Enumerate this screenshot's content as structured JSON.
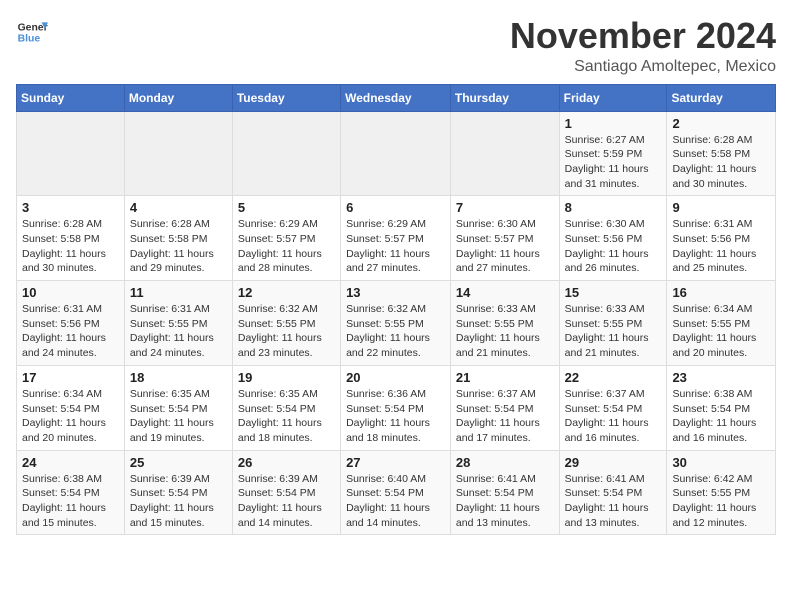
{
  "logo": {
    "line1": "General",
    "line2": "Blue"
  },
  "title": "November 2024",
  "location": "Santiago Amoltepec, Mexico",
  "days_of_week": [
    "Sunday",
    "Monday",
    "Tuesday",
    "Wednesday",
    "Thursday",
    "Friday",
    "Saturday"
  ],
  "weeks": [
    [
      {
        "day": "",
        "info": ""
      },
      {
        "day": "",
        "info": ""
      },
      {
        "day": "",
        "info": ""
      },
      {
        "day": "",
        "info": ""
      },
      {
        "day": "",
        "info": ""
      },
      {
        "day": "1",
        "info": "Sunrise: 6:27 AM\nSunset: 5:59 PM\nDaylight: 11 hours and 31 minutes."
      },
      {
        "day": "2",
        "info": "Sunrise: 6:28 AM\nSunset: 5:58 PM\nDaylight: 11 hours and 30 minutes."
      }
    ],
    [
      {
        "day": "3",
        "info": "Sunrise: 6:28 AM\nSunset: 5:58 PM\nDaylight: 11 hours and 30 minutes."
      },
      {
        "day": "4",
        "info": "Sunrise: 6:28 AM\nSunset: 5:58 PM\nDaylight: 11 hours and 29 minutes."
      },
      {
        "day": "5",
        "info": "Sunrise: 6:29 AM\nSunset: 5:57 PM\nDaylight: 11 hours and 28 minutes."
      },
      {
        "day": "6",
        "info": "Sunrise: 6:29 AM\nSunset: 5:57 PM\nDaylight: 11 hours and 27 minutes."
      },
      {
        "day": "7",
        "info": "Sunrise: 6:30 AM\nSunset: 5:57 PM\nDaylight: 11 hours and 27 minutes."
      },
      {
        "day": "8",
        "info": "Sunrise: 6:30 AM\nSunset: 5:56 PM\nDaylight: 11 hours and 26 minutes."
      },
      {
        "day": "9",
        "info": "Sunrise: 6:31 AM\nSunset: 5:56 PM\nDaylight: 11 hours and 25 minutes."
      }
    ],
    [
      {
        "day": "10",
        "info": "Sunrise: 6:31 AM\nSunset: 5:56 PM\nDaylight: 11 hours and 24 minutes."
      },
      {
        "day": "11",
        "info": "Sunrise: 6:31 AM\nSunset: 5:55 PM\nDaylight: 11 hours and 24 minutes."
      },
      {
        "day": "12",
        "info": "Sunrise: 6:32 AM\nSunset: 5:55 PM\nDaylight: 11 hours and 23 minutes."
      },
      {
        "day": "13",
        "info": "Sunrise: 6:32 AM\nSunset: 5:55 PM\nDaylight: 11 hours and 22 minutes."
      },
      {
        "day": "14",
        "info": "Sunrise: 6:33 AM\nSunset: 5:55 PM\nDaylight: 11 hours and 21 minutes."
      },
      {
        "day": "15",
        "info": "Sunrise: 6:33 AM\nSunset: 5:55 PM\nDaylight: 11 hours and 21 minutes."
      },
      {
        "day": "16",
        "info": "Sunrise: 6:34 AM\nSunset: 5:55 PM\nDaylight: 11 hours and 20 minutes."
      }
    ],
    [
      {
        "day": "17",
        "info": "Sunrise: 6:34 AM\nSunset: 5:54 PM\nDaylight: 11 hours and 20 minutes."
      },
      {
        "day": "18",
        "info": "Sunrise: 6:35 AM\nSunset: 5:54 PM\nDaylight: 11 hours and 19 minutes."
      },
      {
        "day": "19",
        "info": "Sunrise: 6:35 AM\nSunset: 5:54 PM\nDaylight: 11 hours and 18 minutes."
      },
      {
        "day": "20",
        "info": "Sunrise: 6:36 AM\nSunset: 5:54 PM\nDaylight: 11 hours and 18 minutes."
      },
      {
        "day": "21",
        "info": "Sunrise: 6:37 AM\nSunset: 5:54 PM\nDaylight: 11 hours and 17 minutes."
      },
      {
        "day": "22",
        "info": "Sunrise: 6:37 AM\nSunset: 5:54 PM\nDaylight: 11 hours and 16 minutes."
      },
      {
        "day": "23",
        "info": "Sunrise: 6:38 AM\nSunset: 5:54 PM\nDaylight: 11 hours and 16 minutes."
      }
    ],
    [
      {
        "day": "24",
        "info": "Sunrise: 6:38 AM\nSunset: 5:54 PM\nDaylight: 11 hours and 15 minutes."
      },
      {
        "day": "25",
        "info": "Sunrise: 6:39 AM\nSunset: 5:54 PM\nDaylight: 11 hours and 15 minutes."
      },
      {
        "day": "26",
        "info": "Sunrise: 6:39 AM\nSunset: 5:54 PM\nDaylight: 11 hours and 14 minutes."
      },
      {
        "day": "27",
        "info": "Sunrise: 6:40 AM\nSunset: 5:54 PM\nDaylight: 11 hours and 14 minutes."
      },
      {
        "day": "28",
        "info": "Sunrise: 6:41 AM\nSunset: 5:54 PM\nDaylight: 11 hours and 13 minutes."
      },
      {
        "day": "29",
        "info": "Sunrise: 6:41 AM\nSunset: 5:54 PM\nDaylight: 11 hours and 13 minutes."
      },
      {
        "day": "30",
        "info": "Sunrise: 6:42 AM\nSunset: 5:55 PM\nDaylight: 11 hours and 12 minutes."
      }
    ]
  ]
}
